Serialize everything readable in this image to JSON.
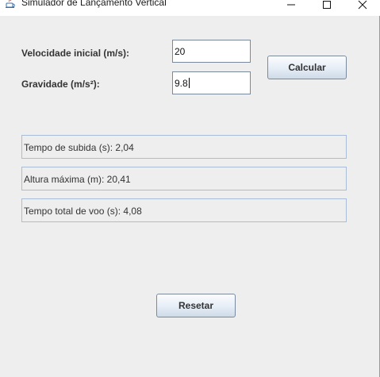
{
  "window": {
    "title": "Simulador de Lançamento Vertical",
    "icon": "java-cup-icon",
    "controls": [
      "minimize-icon",
      "maximize-icon",
      "close-icon"
    ]
  },
  "form": {
    "velocity_label": "Velocidade inicial (m/s):",
    "velocity_value": "20",
    "gravity_label": "Gravidade (m/s²):",
    "gravity_value": "9.8"
  },
  "buttons": {
    "calculate_label": "Calcular",
    "reset_label": "Resetar"
  },
  "results": {
    "rise_time": "Tempo de subida (s): 2,04",
    "max_height": "Altura máxima (m): 20,41",
    "total_time": "Tempo total de voo (s): 4,08"
  },
  "colors": {
    "background": "#eeeeee",
    "field_border": "#7a8a9c",
    "result_border": "#a9bed6"
  }
}
